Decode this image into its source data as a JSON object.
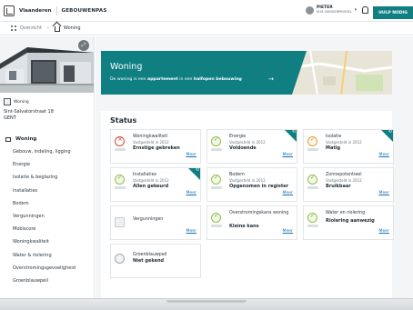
{
  "header": {
    "brand": "Vlaanderen",
    "app_name": "GEBOUWENPAS",
    "user_name": "PIETER",
    "user_role": "M.M. BURGERPROFIEL",
    "help_button": "HULP NODIG"
  },
  "breadcrumb": {
    "overview": "Overzicht",
    "current": "Woning"
  },
  "sidebar": {
    "tag": "Woning",
    "address_line1": "Sint-Salvatorstraat 18",
    "address_line2": "GENT",
    "nav_head": "Woning",
    "items": [
      "Gebouw, indeling, ligging",
      "Energie",
      "Isolatie & beglazing",
      "Installaties",
      "Bodem",
      "Vergunningen",
      "Mobiscore",
      "Woningkwaliteit",
      "Water & riolering",
      "Overstromingsgevoeligheid",
      "Groenblauwpeil"
    ]
  },
  "hero": {
    "title": "Woning",
    "desc_prefix": "De woning is een",
    "desc_type": "appartement",
    "desc_mid": "in een",
    "desc_building": "halfopen bebouwing",
    "arrow": "→"
  },
  "status": {
    "title": "Status",
    "more_label": "Meer",
    "cards": [
      {
        "title": "Woningkwaliteit",
        "sub": "Vastgesteld in 2012",
        "value": "Ernstige gebreken",
        "icon": "cross-circle-icon",
        "color": "#d2453d"
      },
      {
        "title": "Energie",
        "sub": "Vastgesteld in 2012",
        "value": "Voldoende",
        "icon": "check-circle-icon",
        "color": "#8fc148"
      },
      {
        "title": "Isolatie",
        "sub": "Vastgesteld in 2012",
        "value": "Matig",
        "icon": "check-circle-icon",
        "color": "#e4a03a"
      },
      {
        "title": "Installaties",
        "sub": "Vastgesteld in 2012",
        "value": "Allen gekeurd",
        "icon": "check-circle-icon",
        "color": "#8fc148"
      },
      {
        "title": "Bodem",
        "sub": "Vastgesteld in 2012",
        "value": "Opgenomen in register",
        "icon": "check-circle-icon",
        "color": "#8fc148"
      },
      {
        "title": "Zonnepotentieel",
        "sub": "Vastgesteld in 2012",
        "value": "Bruikbaar",
        "icon": "check-circle-icon",
        "color": "#8fc148"
      },
      {
        "title": "Vergunningen",
        "sub": "",
        "value": "",
        "icon": "document-icon",
        "color": "#c9ced2"
      },
      {
        "title": "Overstromingskans woning",
        "sub": "",
        "value": "Kleine kans",
        "icon": "check-circle-icon",
        "color": "#8fc148"
      },
      {
        "title": "Water en riolering",
        "sub": "",
        "value": "Riolering aanwezig",
        "icon": "check-circle-icon",
        "color": "#8fc148"
      },
      {
        "title": "Groenblauwpeil",
        "sub": "",
        "value": "Niet gekend",
        "icon": "drop-icon",
        "color": "#9fa7ad"
      }
    ]
  }
}
